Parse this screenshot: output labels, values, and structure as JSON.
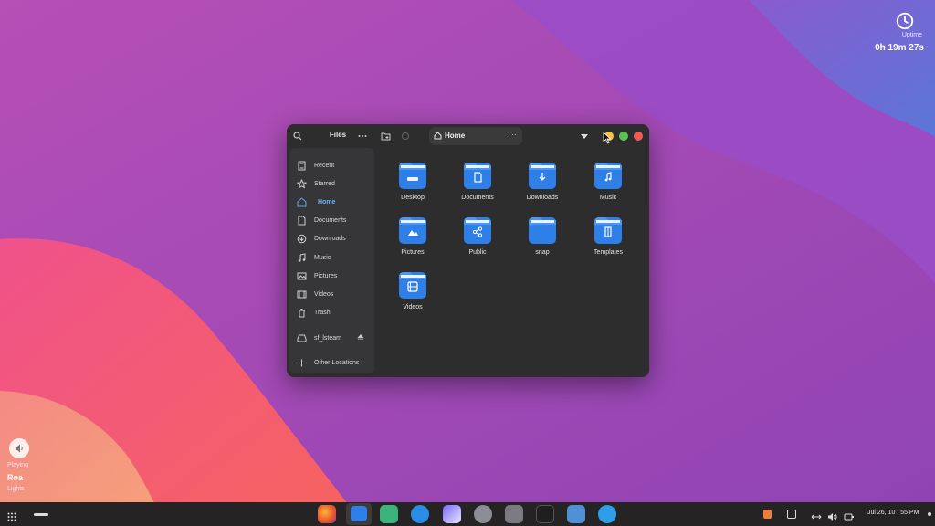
{
  "desktop": {
    "uptime": {
      "label": "Uptime",
      "value": "0h 19m 27s",
      "icon": "clock-icon"
    },
    "now_playing": {
      "status": "Playing",
      "title": "Roa",
      "artist": "Lights",
      "icon": "audio-icon"
    },
    "colors": {
      "wallpaper_base": "#a24bb4",
      "wallpaper_pink": "#f25a80",
      "wallpaper_blue": "#6a73d6"
    }
  },
  "window": {
    "title": "Files",
    "path": "Home",
    "icons": {
      "search": "search-icon",
      "menu": "dots-icon",
      "new_folder": "new-folder-icon",
      "history": "history-icon"
    },
    "controls": {
      "minimize_color": "#f5c242",
      "maximize_color": "#58c252",
      "close_color": "#ef5b5b"
    },
    "sidebar": {
      "items": [
        {
          "label": "Recent",
          "icon": "recent-icon"
        },
        {
          "label": "Starred",
          "icon": "star-icon"
        },
        {
          "label": "Home",
          "icon": "home-icon",
          "active": true
        },
        {
          "label": "Documents",
          "icon": "document-icon"
        },
        {
          "label": "Downloads",
          "icon": "download-icon"
        },
        {
          "label": "Music",
          "icon": "music-icon"
        },
        {
          "label": "Pictures",
          "icon": "picture-icon"
        },
        {
          "label": "Videos",
          "icon": "video-icon"
        },
        {
          "label": "Trash",
          "icon": "trash-icon"
        },
        {
          "label": "sf_lsteam",
          "icon": "drive-icon"
        },
        {
          "label": "Other Locations",
          "icon": "plus-icon"
        }
      ]
    },
    "folders": [
      {
        "label": "Desktop",
        "icon": "desktop-folder-icon"
      },
      {
        "label": "Documents",
        "icon": "documents-folder-icon"
      },
      {
        "label": "Downloads",
        "icon": "downloads-folder-icon"
      },
      {
        "label": "Music",
        "icon": "music-folder-icon"
      },
      {
        "label": "Pictures",
        "icon": "pictures-folder-icon"
      },
      {
        "label": "Public",
        "icon": "public-folder-icon"
      },
      {
        "label": "snap",
        "icon": "folder-icon"
      },
      {
        "label": "Templates",
        "icon": "templates-folder-icon"
      },
      {
        "label": "Videos",
        "icon": "videos-folder-icon"
      }
    ],
    "accent": "#2f7fe8"
  },
  "taskbar": {
    "clock": "Jul 26, 10 : 55 PM",
    "apps": [
      "firefox-icon",
      "files-icon",
      "extensions-icon",
      "browser-icon",
      "media-icon",
      "settings-icon",
      "disks-icon",
      "terminal-icon",
      "software-icon",
      "video-player-icon"
    ]
  }
}
